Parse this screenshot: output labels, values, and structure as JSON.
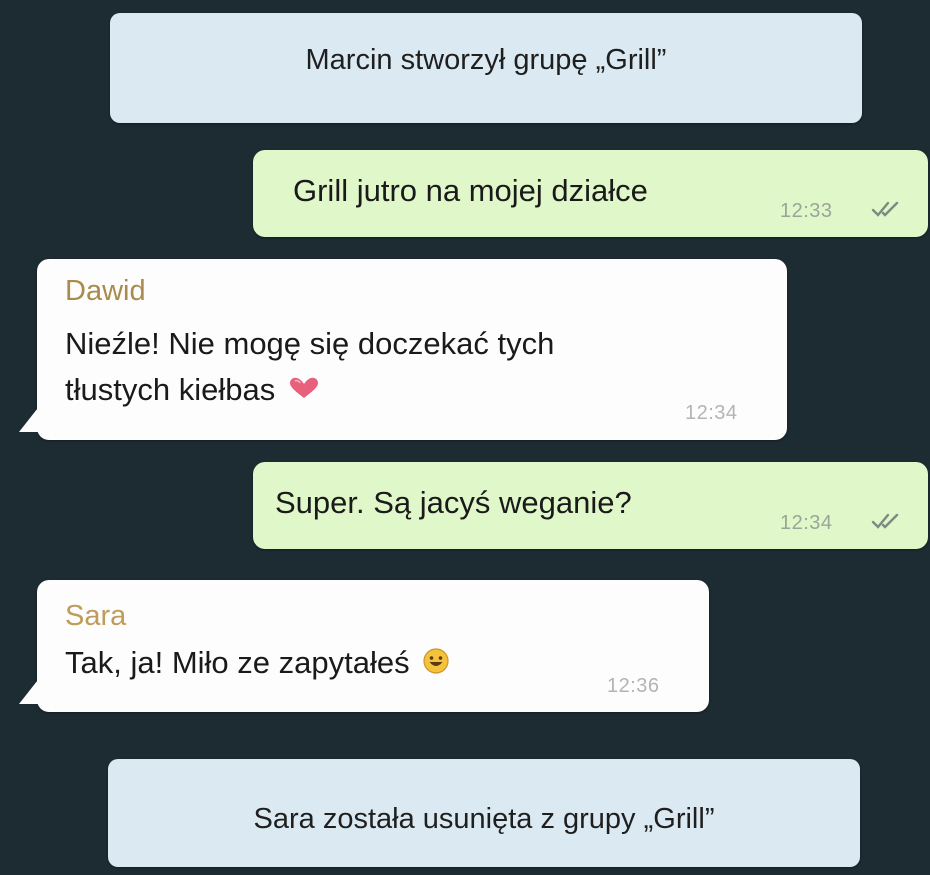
{
  "chat": {
    "group_created": "Marcin stworzył grupę „Grill”",
    "messages": [
      {
        "direction": "outgoing",
        "text": "Grill jutro na mojej działce",
        "time": "12:33",
        "status": "read-double-check-icon"
      },
      {
        "direction": "incoming",
        "sender": "Dawid",
        "sender_color": "#a88c4c",
        "text_line1": "Nieźle! Nie mogę się doczekać tych",
        "text_line2": "tłustych kiełbas",
        "emoji": "heart-emoji-icon",
        "time": "12:34"
      },
      {
        "direction": "outgoing",
        "text": "Super. Są jacyś weganie?",
        "time": "12:34",
        "status": "read-double-check-icon"
      },
      {
        "direction": "incoming",
        "sender": "Sara",
        "sender_color": "#c09c5a",
        "text": "Tak, ja! Miło ze zapytałeś",
        "emoji": "smiling-face-emoji-icon",
        "time": "12:36"
      }
    ],
    "member_removed": "Sara została usunięta z grupy „Grill”"
  },
  "colors": {
    "background": "#1d2b32",
    "system_bubble": "#dbe9f2",
    "outgoing_bubble": "#e0f7c9",
    "incoming_bubble": "#fdfdfd",
    "read_ticks": "#7c8a80"
  }
}
